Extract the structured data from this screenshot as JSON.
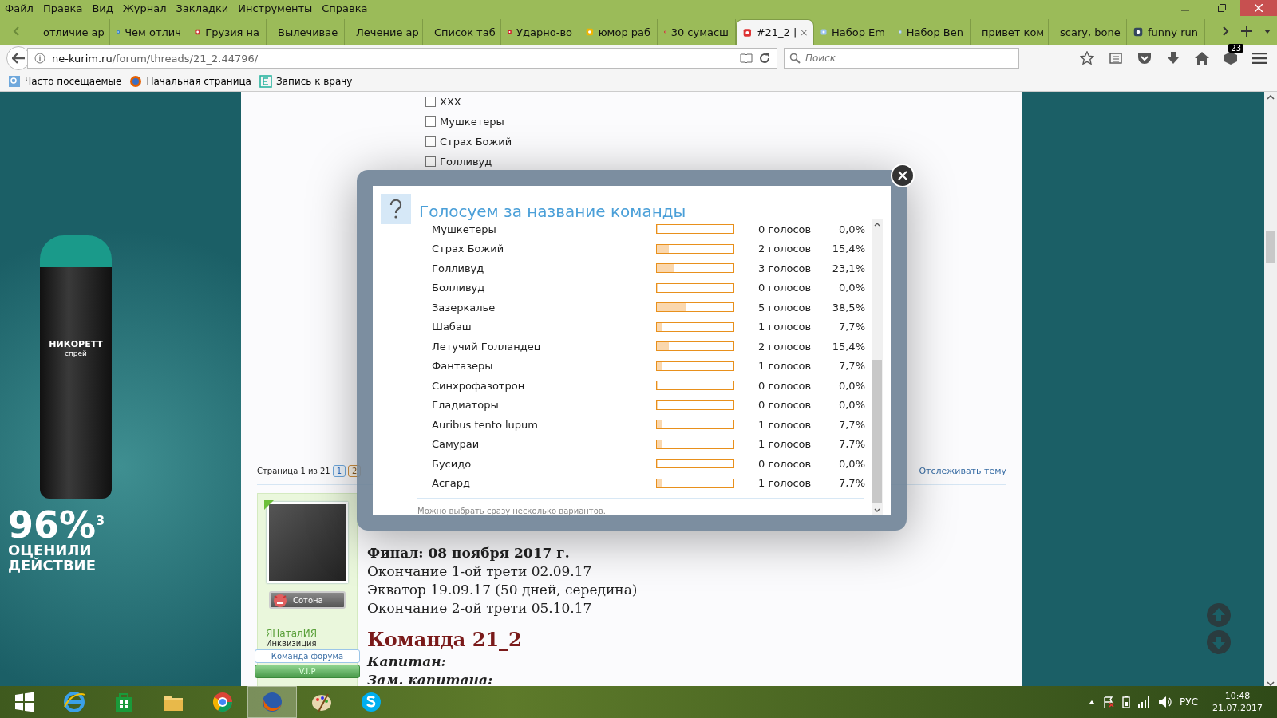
{
  "menu": [
    "Файл",
    "Правка",
    "Вид",
    "Журнал",
    "Закладки",
    "Инструменты",
    "Справка"
  ],
  "tabs": [
    {
      "label": "отличие ар",
      "selected": false
    },
    {
      "label": "Чем отлич",
      "selected": false
    },
    {
      "label": "Грузия на",
      "selected": false
    },
    {
      "label": "Вылечивае",
      "selected": false
    },
    {
      "label": "Лечение ар",
      "selected": false
    },
    {
      "label": "Список таб",
      "selected": false
    },
    {
      "label": "Ударно-во",
      "selected": false
    },
    {
      "label": "юмор раб",
      "selected": false
    },
    {
      "label": "30 сумасш",
      "selected": false
    },
    {
      "label": "#21_2 |",
      "selected": true
    },
    {
      "label": "Набор Em",
      "selected": false
    },
    {
      "label": "Набор Ben",
      "selected": false
    },
    {
      "label": "привет ком",
      "selected": false
    },
    {
      "label": "scary, bone",
      "selected": false
    },
    {
      "label": "funny run",
      "selected": false
    }
  ],
  "address": {
    "host": "ne-kurim.ru",
    "path": "/forum/threads/21_2.44796/"
  },
  "search": {
    "placeholder": "Поиск"
  },
  "toolbar_badge": "23",
  "bookmarks": [
    "Часто посещаемые",
    "Начальная страница",
    "Запись к врачу"
  ],
  "ad": {
    "product": "НИКОРЕТТ",
    "form": "спрей",
    "figure": "96%$^{3}$",
    "caption": [
      "ОЦЕНИЛИ",
      "ДЕЙСТВИЕ"
    ]
  },
  "poll_choices": [
    {
      "label": "XXX",
      "checked": false
    },
    {
      "label": "Мушкетеры",
      "checked": false
    },
    {
      "label": "Страх Божий",
      "checked": false
    },
    {
      "label": "Голливуд",
      "checked": false
    }
  ],
  "pagination": {
    "label": "Страница 1 из 21",
    "pages": [
      {
        "label": "1",
        "selected": true
      },
      {
        "label": "2",
        "selected": false
      }
    ]
  },
  "watch_link": "Отслеживать тему",
  "author": {
    "rank": "Сотона",
    "name": "ЯНаталИЯ",
    "title": "Инквизиция",
    "online": true,
    "banners": [
      {
        "label": "Команда форума",
        "kind": "staff"
      },
      {
        "label": "V.I.P",
        "kind": "vip"
      }
    ]
  },
  "post_lines": [
    {
      "text": "Финал: 08 ноября 2017 г.",
      "kind": "bold"
    },
    {
      "text": "Окончание 1-ой трети 02.09.17",
      "kind": "plain"
    },
    {
      "text": "Экватор 19.09.17 (50 дней, середина)",
      "kind": "plain"
    },
    {
      "text": "Окончание 2-ой трети 05.10.17",
      "kind": "plain"
    },
    {
      "text": "Команда 21_2",
      "kind": "heading"
    },
    {
      "text": "Капитан:",
      "kind": "label"
    },
    {
      "text": "Зам. капитана:",
      "kind": "label"
    }
  ],
  "poll": {
    "title": "Голосуем за название команды",
    "note": "Можно выбрать сразу несколько вариантов.",
    "options": [
      {
        "name": "Мушкетеры",
        "level": 0,
        "votes": "0 голосов",
        "percent": "0,0%"
      },
      {
        "name": "Страх Божий",
        "level": 0.154,
        "votes": "2 голосов",
        "percent": "15,4%"
      },
      {
        "name": "Голливуд",
        "level": 0.231,
        "votes": "3 голосов",
        "percent": "23,1%"
      },
      {
        "name": "Болливуд",
        "level": 0,
        "votes": "0 голосов",
        "percent": "0,0%"
      },
      {
        "name": "Зазеркалье",
        "level": 0.385,
        "votes": "5 голосов",
        "percent": "38,5%"
      },
      {
        "name": "Шабаш",
        "level": 0.077,
        "votes": "1 голосов",
        "percent": "7,7%"
      },
      {
        "name": "Летучий Голландец",
        "level": 0.154,
        "votes": "2 голосов",
        "percent": "15,4%"
      },
      {
        "name": "Фантазеры",
        "level": 0.077,
        "votes": "1 голосов",
        "percent": "7,7%"
      },
      {
        "name": "Синхрофазотрон",
        "level": 0,
        "votes": "0 голосов",
        "percent": "0,0%"
      },
      {
        "name": "Гладиаторы",
        "level": 0,
        "votes": "0 голосов",
        "percent": "0,0%"
      },
      {
        "name": "Auribus tento lupum",
        "level": 0.077,
        "votes": "1 голосов",
        "percent": "7,7%"
      },
      {
        "name": "Самураи",
        "level": 0.077,
        "votes": "1 голосов",
        "percent": "7,7%"
      },
      {
        "name": "Бусидо",
        "level": 0,
        "votes": "0 голосов",
        "percent": "0,0%"
      },
      {
        "name": "Асгард",
        "level": 0.077,
        "votes": "1 голосов",
        "percent": "7,7%"
      }
    ]
  },
  "taskbar": {
    "language": "РУС",
    "time": "10:48",
    "date": "21.07.2017"
  }
}
